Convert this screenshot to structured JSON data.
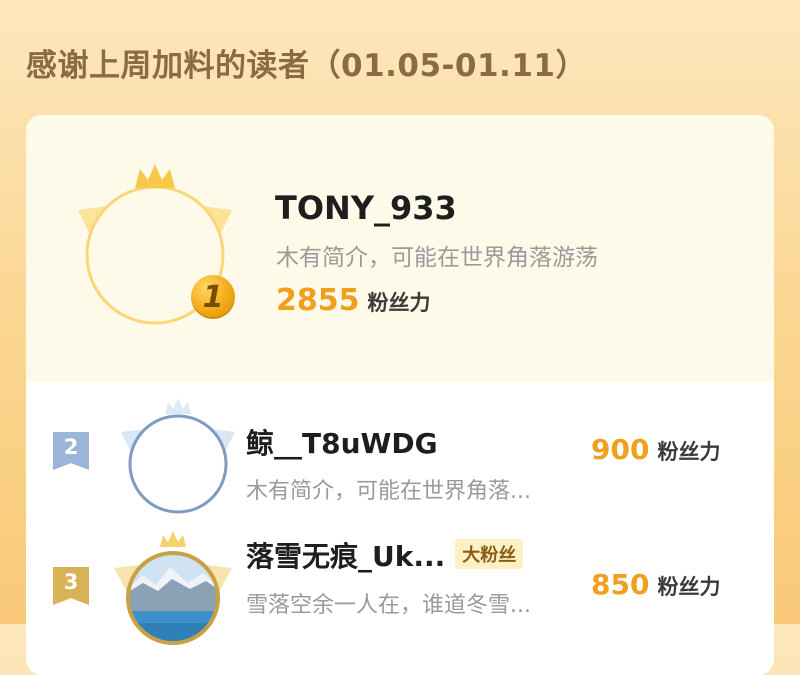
{
  "header": {
    "title": "感谢上周加料的读者（01.05-01.11）"
  },
  "readers": [
    {
      "rank": "1",
      "name": "TONY_933",
      "bio": "木有简介，可能在世界角落游荡",
      "fans": "2855",
      "fans_label": "粉丝力"
    },
    {
      "rank": "2",
      "name": "鲸__T8uWDG",
      "bio": "木有简介，可能在世界角落...",
      "fans": "900",
      "fans_label": "粉丝力"
    },
    {
      "rank": "3",
      "name": "落雪无痕_Uk...",
      "tag": "大粉丝",
      "bio": "雪落空余一人在，谁道冬雪...",
      "fans": "850",
      "fans_label": "粉丝力"
    }
  ],
  "colors": {
    "accent": "#f0a01c",
    "gold": "#f2a915",
    "silver": "#9bb5d8",
    "bronze": "#d8b257"
  },
  "icons": {
    "crown": "crown-icon",
    "wings": "wings-icon"
  }
}
